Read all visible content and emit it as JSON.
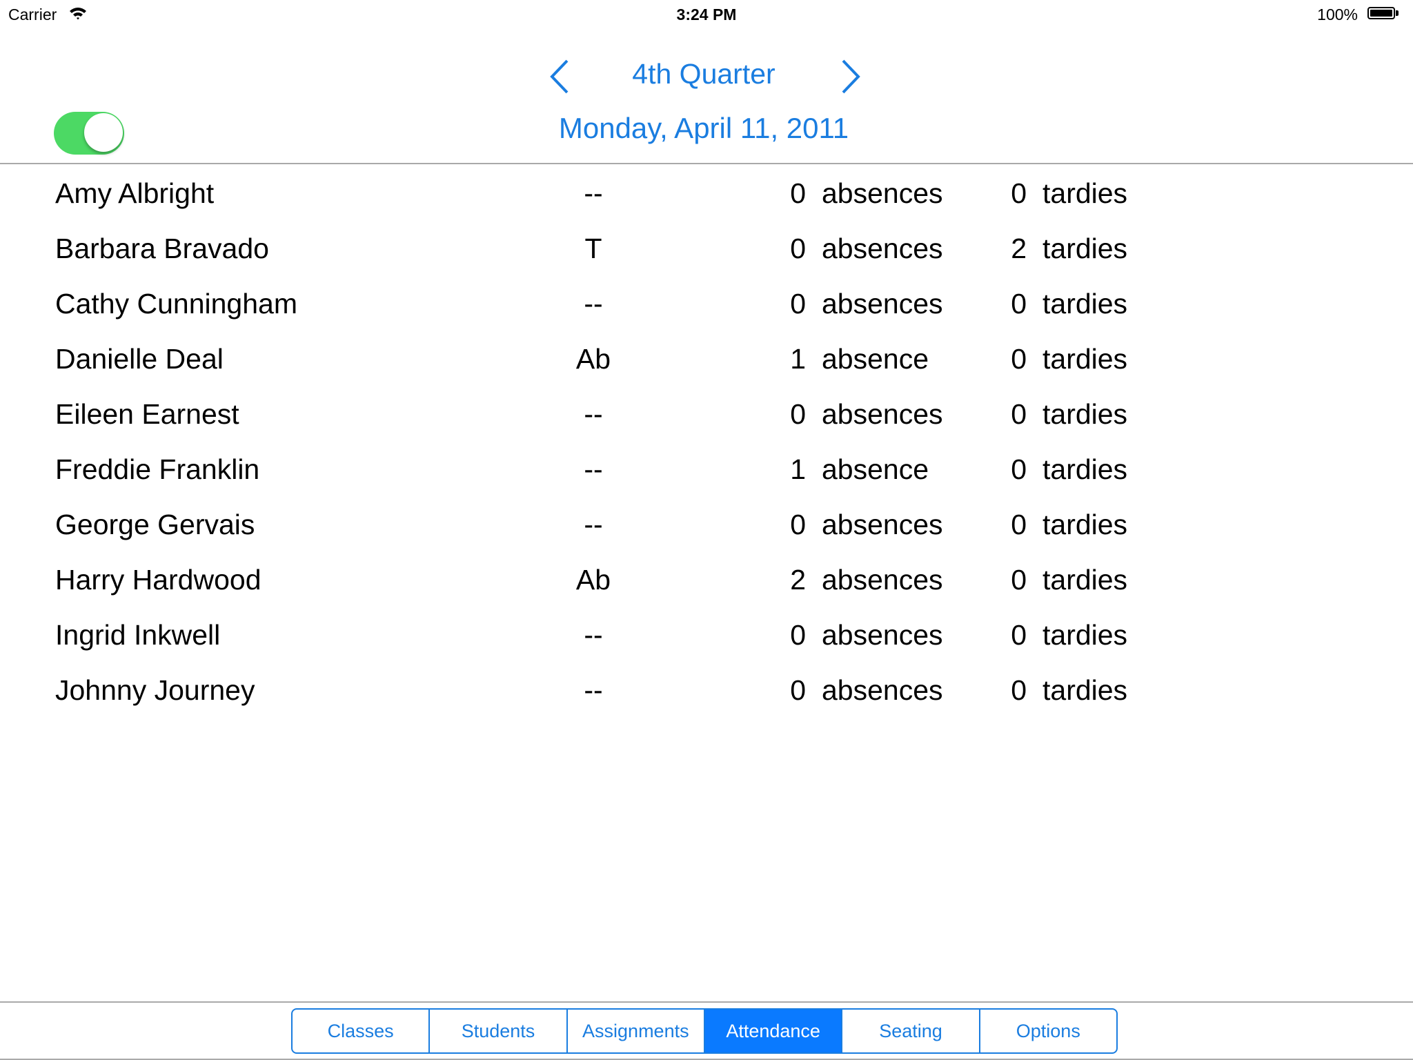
{
  "status_bar": {
    "carrier": "Carrier",
    "wifi_icon": "wifi-icon",
    "time": "3:24 PM",
    "battery_percent": "100%",
    "battery_icon": "battery-icon",
    "battery_level": 1.0
  },
  "header": {
    "prev_icon": "chevron-left-icon",
    "next_icon": "chevron-right-icon",
    "period": "4th Quarter",
    "date": "Monday, April 11, 2011",
    "toggle_on": true,
    "accent_color": "#1a7de0",
    "toggle_color": "#4cd964"
  },
  "students": [
    {
      "name": "Amy Albright",
      "code": "--",
      "absences": "0",
      "absence_label": "absences",
      "tardies": "0",
      "tardy_label": "tardies"
    },
    {
      "name": "Barbara Bravado",
      "code": "T",
      "absences": "0",
      "absence_label": "absences",
      "tardies": "2",
      "tardy_label": "tardies"
    },
    {
      "name": "Cathy Cunningham",
      "code": "--",
      "absences": "0",
      "absence_label": "absences",
      "tardies": "0",
      "tardy_label": "tardies"
    },
    {
      "name": "Danielle Deal",
      "code": "Ab",
      "absences": "1",
      "absence_label": "absence",
      "tardies": "0",
      "tardy_label": "tardies"
    },
    {
      "name": "Eileen Earnest",
      "code": "--",
      "absences": "0",
      "absence_label": "absences",
      "tardies": "0",
      "tardy_label": "tardies"
    },
    {
      "name": "Freddie Franklin",
      "code": "--",
      "absences": "1",
      "absence_label": "absence",
      "tardies": "0",
      "tardy_label": "tardies"
    },
    {
      "name": "George Gervais",
      "code": "--",
      "absences": "0",
      "absence_label": "absences",
      "tardies": "0",
      "tardy_label": "tardies"
    },
    {
      "name": "Harry Hardwood",
      "code": "Ab",
      "absences": "2",
      "absence_label": "absences",
      "tardies": "0",
      "tardy_label": "tardies"
    },
    {
      "name": "Ingrid Inkwell",
      "code": "--",
      "absences": "0",
      "absence_label": "absences",
      "tardies": "0",
      "tardy_label": "tardies"
    },
    {
      "name": "Johnny Journey",
      "code": "--",
      "absences": "0",
      "absence_label": "absences",
      "tardies": "0",
      "tardy_label": "tardies"
    }
  ],
  "tabs": {
    "items": [
      {
        "label": "Classes",
        "active": false
      },
      {
        "label": "Students",
        "active": false
      },
      {
        "label": "Assignments",
        "active": false
      },
      {
        "label": "Attendance",
        "active": true
      },
      {
        "label": "Seating",
        "active": false
      },
      {
        "label": "Options",
        "active": false
      }
    ],
    "active_color": "#0a7aff"
  }
}
